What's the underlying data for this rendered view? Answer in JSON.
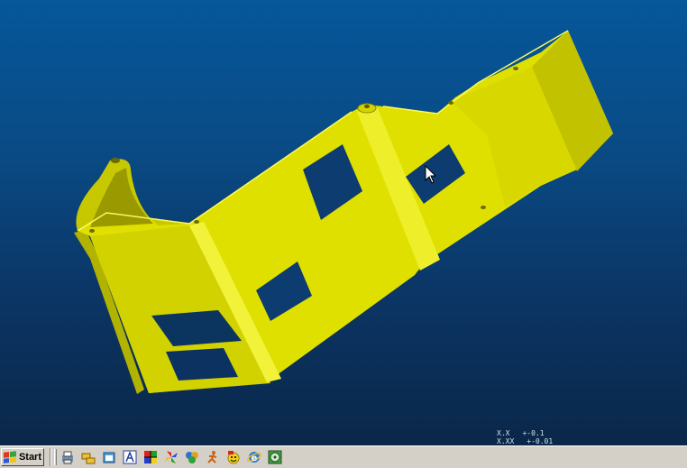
{
  "window": {
    "viewport_background": [
      "#05579a",
      "#0a2749"
    ],
    "model_color": "#e6e600"
  },
  "status": {
    "tolerance": [
      {
        "format": "X.X",
        "value": "+-0.1"
      },
      {
        "format": "X.XX",
        "value": "+-0.01"
      }
    ]
  },
  "taskbar": {
    "start_label": "Start",
    "quick_launch": [
      {
        "icon": "printer-app-icon"
      },
      {
        "icon": "folder-tree-icon"
      },
      {
        "icon": "box-window-icon"
      },
      {
        "icon": "font-a-icon"
      },
      {
        "icon": "color-grid-icon"
      },
      {
        "icon": "pinwheel-icon"
      },
      {
        "icon": "puzzle-pieces-icon"
      },
      {
        "icon": "runner-figure-icon"
      },
      {
        "icon": "smiley-badge-icon"
      },
      {
        "icon": "internet-explorer-icon"
      },
      {
        "icon": "cd-player-icon"
      }
    ]
  }
}
